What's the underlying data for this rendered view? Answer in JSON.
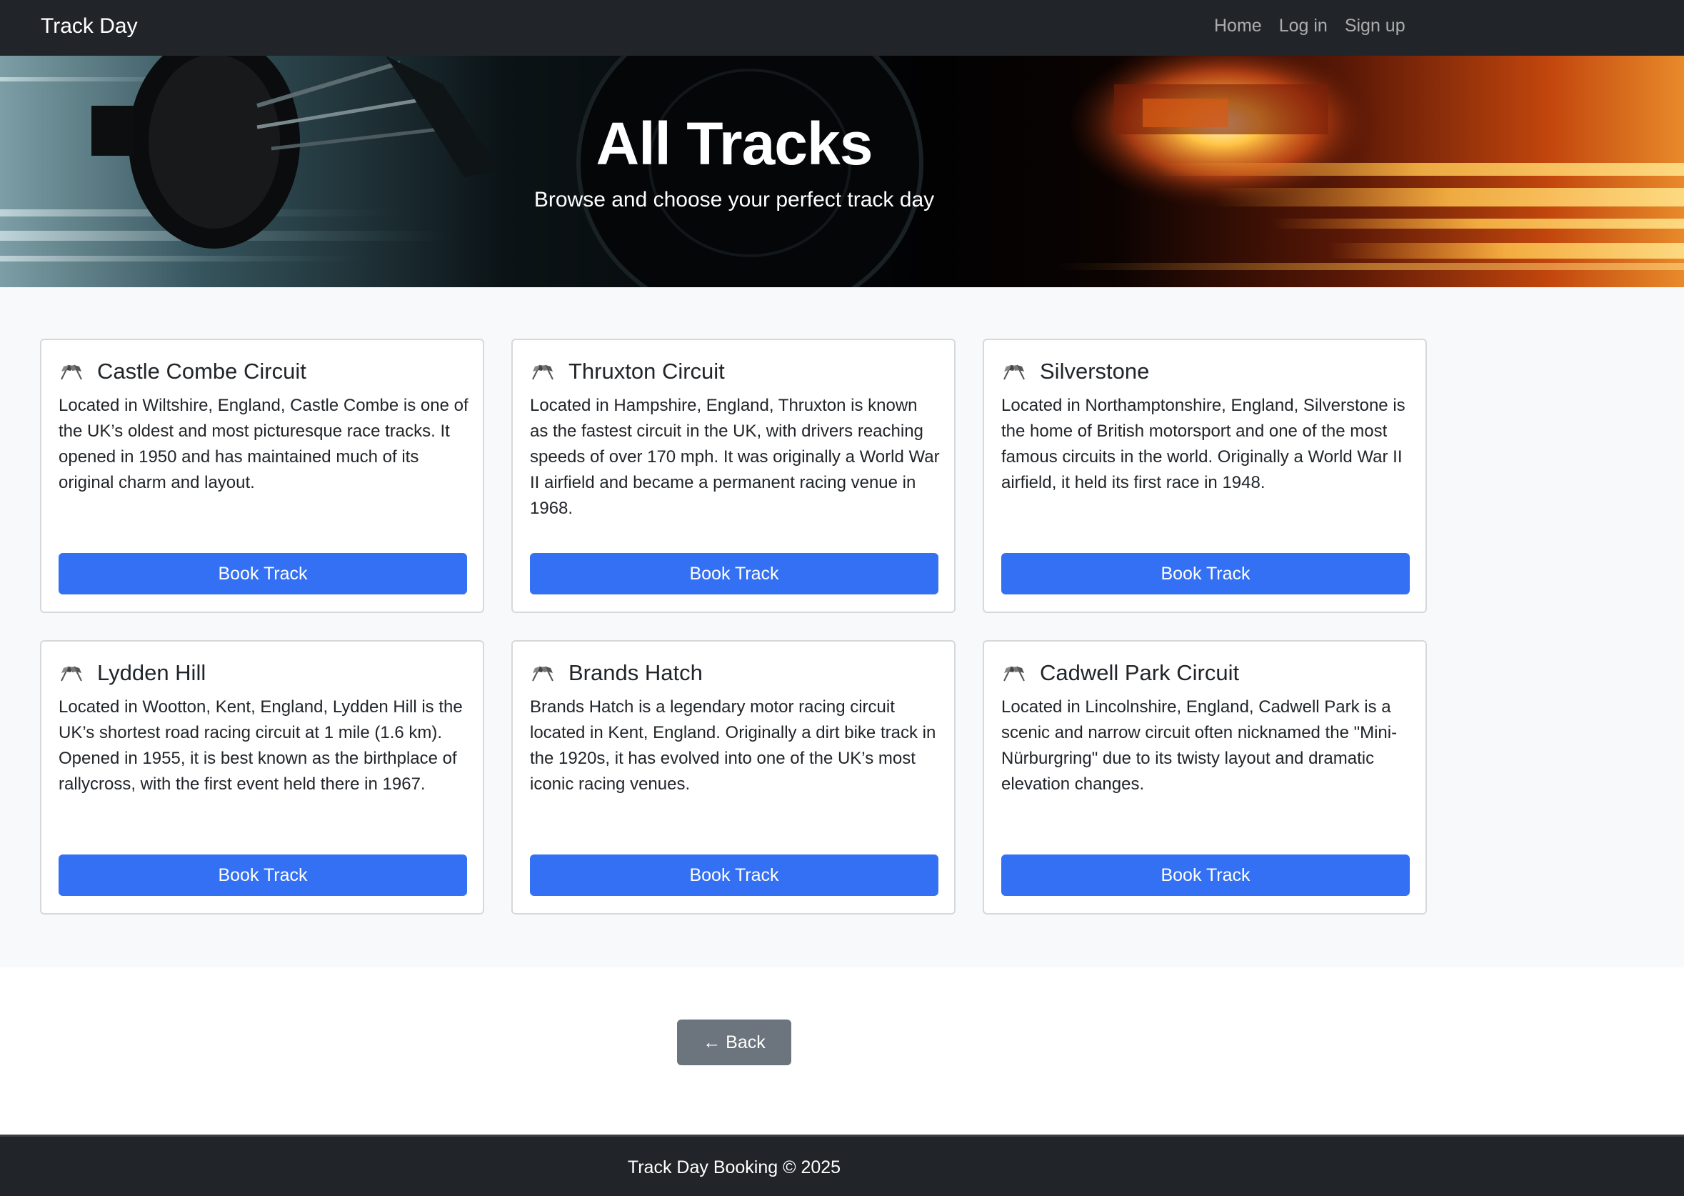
{
  "navbar": {
    "brand": "Track Day",
    "links": [
      "Home",
      "Log in",
      "Sign up"
    ]
  },
  "hero": {
    "title": "All Tracks",
    "subtitle": "Browse and choose your perfect track day"
  },
  "cards": [
    {
      "icon": "checkered-flag-icon",
      "title": "Castle Combe Circuit",
      "description": "Located in Wiltshire, England, Castle Combe is one of the UK’s oldest and most picturesque race tracks. It opened in 1950 and has maintained much of its original charm and layout.",
      "button": "Book Track"
    },
    {
      "icon": "checkered-flag-icon",
      "title": "Thruxton Circuit",
      "description": "Located in Hampshire, England, Thruxton is known as the fastest circuit in the UK, with drivers reaching speeds of over 170 mph. It was originally a World War II airfield and became a permanent racing venue in 1968.",
      "button": "Book Track"
    },
    {
      "icon": "checkered-flag-icon",
      "title": "Silverstone",
      "description": "Located in Northamptonshire, England, Silverstone is the home of British motorsport and one of the most famous circuits in the world. Originally a World War II airfield, it held its first race in 1948.",
      "button": "Book Track"
    },
    {
      "icon": "checkered-flag-icon",
      "title": "Lydden Hill",
      "description": "Located in Wootton, Kent, England, Lydden Hill is the UK’s shortest road racing circuit at 1 mile (1.6 km). Opened in 1955, it is best known as the birthplace of rallycross, with the first event held there in 1967.",
      "button": "Book Track"
    },
    {
      "icon": "checkered-flag-icon",
      "title": "Brands Hatch",
      "description": "Brands Hatch is a legendary motor racing circuit located in Kent, England. Originally a dirt bike track in the 1920s, it has evolved into one of the UK’s most iconic racing venues.",
      "button": "Book Track"
    },
    {
      "icon": "checkered-flag-icon",
      "title": "Cadwell Park Circuit",
      "description": "Located in Lincolnshire, England, Cadwell Park is a scenic and narrow circuit often nicknamed the \"Mini-Nürburgring\" due to its twisty layout and dramatic elevation changes.",
      "button": "Book Track"
    }
  ],
  "back_button": {
    "icon": "left-arrow-icon",
    "label": "← Back"
  },
  "footer": {
    "text": "Track Day Booking © 2025"
  },
  "colors": {
    "navbar_bg": "#212529",
    "primary_button": "#3470f3",
    "secondary_button": "#6c757d",
    "section_bg": "#f8f9fa"
  }
}
